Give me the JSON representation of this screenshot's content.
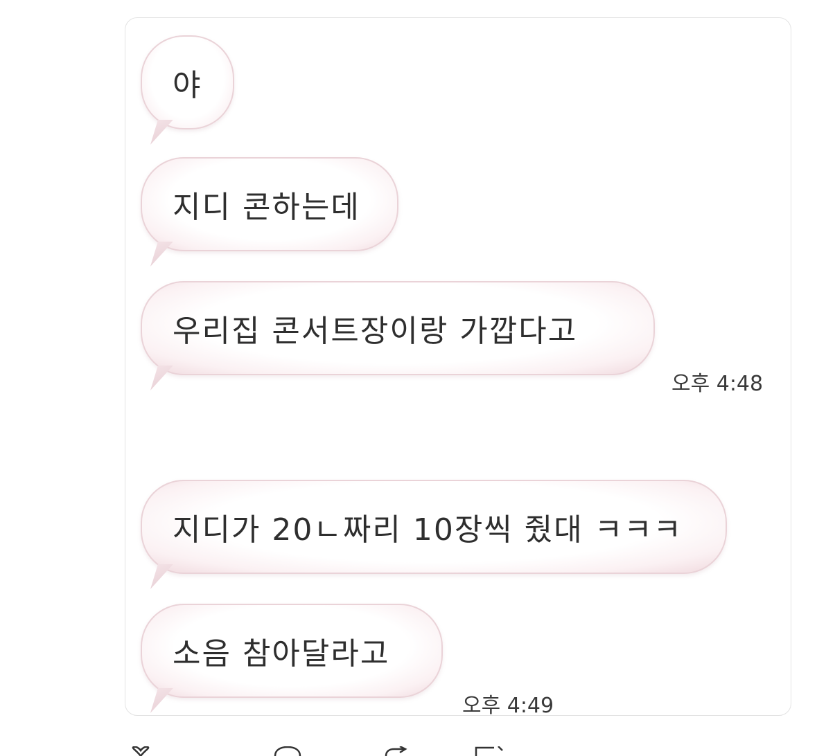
{
  "messages": [
    {
      "text": "야"
    },
    {
      "text": "지디 콘하는데"
    },
    {
      "text": "우리집 콘서트장이랑 가깝다고",
      "time": "오후 4:48"
    },
    {
      "text": "지디가 20ㄴ짜리 10장씩 줬대 ㅋㅋㅋ"
    },
    {
      "text": "소음 참아달라고",
      "time": "오후 4:49"
    }
  ],
  "actions": [
    {
      "icon": "heart-icon"
    },
    {
      "icon": "comment-icon"
    },
    {
      "icon": "share-icon"
    },
    {
      "icon": "bookmark-icon"
    }
  ],
  "colors": {
    "bubble_edge": "#ead3d8",
    "bubble_fill": "#ffffff",
    "text": "#2e2e2e",
    "card_border": "#e3e3e3"
  }
}
